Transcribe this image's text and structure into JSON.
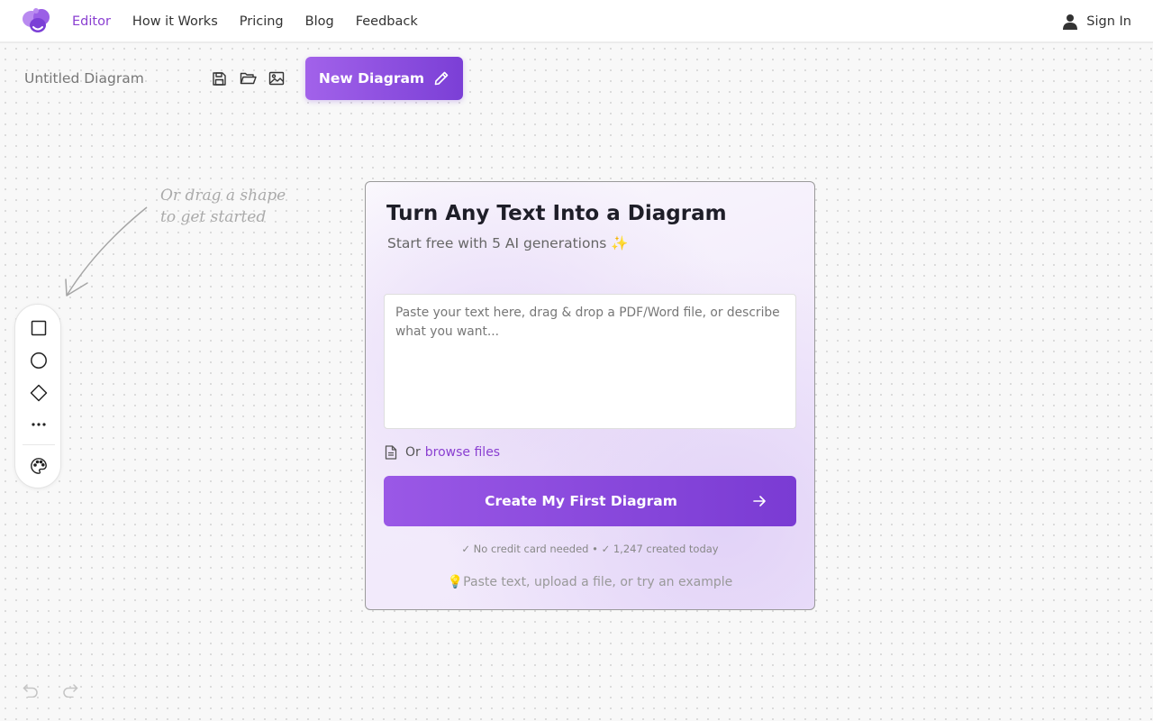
{
  "nav": {
    "logo": "logo-icon",
    "links": [
      {
        "label": "Editor",
        "active": true
      },
      {
        "label": "How it Works",
        "active": false
      },
      {
        "label": "Pricing",
        "active": false
      },
      {
        "label": "Blog",
        "active": false
      },
      {
        "label": "Feedback",
        "active": false
      }
    ],
    "signin_label": "Sign In",
    "signin_icon": "user-icon"
  },
  "toolbar": {
    "doc_title": "Untitled Diagram",
    "icons": [
      "save-icon",
      "folder-open-icon",
      "image-icon"
    ],
    "new_diagram_label": "New Diagram",
    "new_diagram_icon": "pencil-icon"
  },
  "hint": {
    "text": "Or drag a shape\nto get started"
  },
  "shape_palette": {
    "tools": [
      "rectangle-icon",
      "circle-icon",
      "diamond-icon",
      "more-icon",
      "palette-icon"
    ]
  },
  "card": {
    "title": "Turn Any Text Into a Diagram",
    "subtitle": "Start free with 5 AI generations ✨",
    "textarea_placeholder": "Paste your text here, drag & drop a PDF/Word file, or describe what you want...",
    "browse_prefix": "Or",
    "browse_link": "browse files",
    "create_label": "Create My First Diagram",
    "trust_line": "✓ No credit card needed • ✓ 1,247 created today",
    "tip_line": "💡Paste text, upload a file, or try an example"
  },
  "history": {
    "undo_icon": "undo-icon",
    "redo_icon": "redo-icon"
  },
  "colors": {
    "accent": "#8a3fd1",
    "button_start": "#a262ea",
    "button_end": "#7b3fd6"
  }
}
